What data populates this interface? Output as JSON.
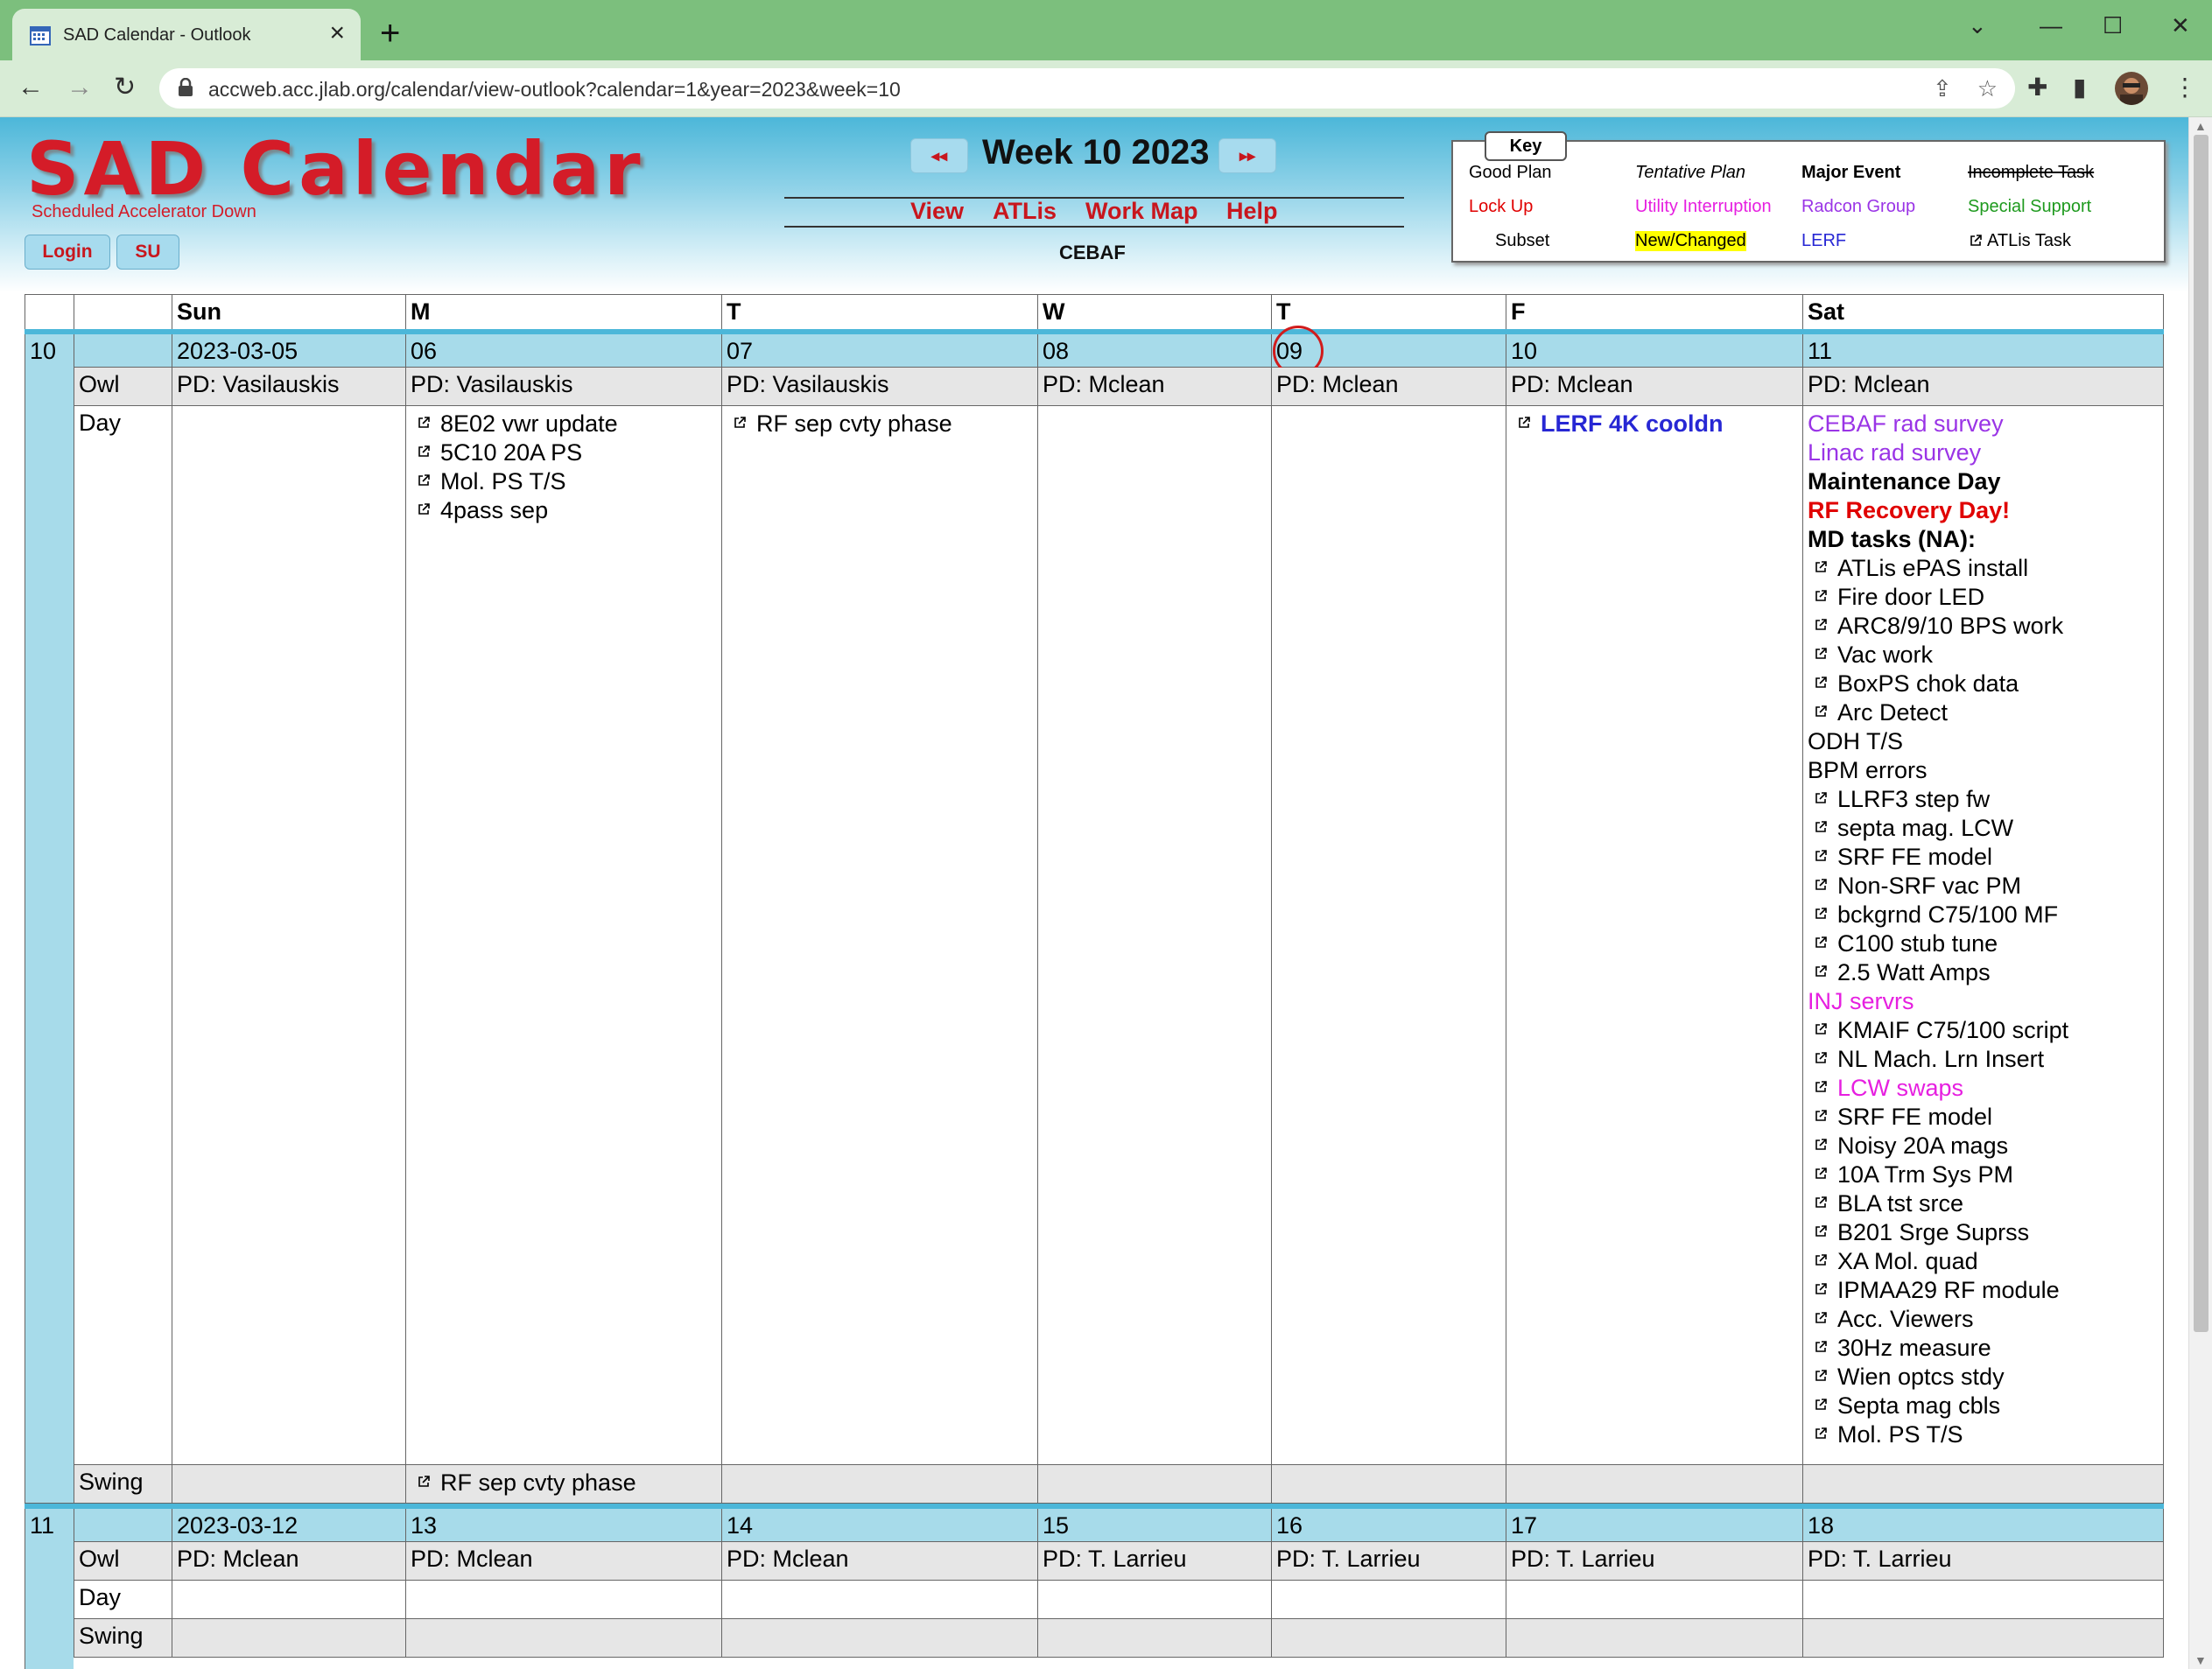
{
  "browser": {
    "tab_title": "SAD Calendar - Outlook",
    "url": "accweb.acc.jlab.org/calendar/view-outlook?calendar=1&year=2023&week=10"
  },
  "header": {
    "logo_title": "SAD Calendar",
    "logo_subtitle": "Scheduled Accelerator Down",
    "login_label": "Login",
    "su_label": "SU",
    "prev_label": "◂◂",
    "next_label": "▸▸",
    "week_title": "Week 10 2023",
    "menu": [
      "View",
      "ATLis",
      "Work Map",
      "Help"
    ],
    "calendar_name": "CEBAF"
  },
  "key": {
    "title": "Key",
    "items": [
      {
        "label": "Good Plan",
        "style": "plain"
      },
      {
        "label": "Tentative Plan",
        "style": "italic"
      },
      {
        "label": "Major Event",
        "style": "bold"
      },
      {
        "label": "Incomplete Task",
        "style": "strike"
      },
      {
        "label": "Lock Up",
        "style": "red"
      },
      {
        "label": "Utility Interruption",
        "style": "magenta"
      },
      {
        "label": "Radcon Group",
        "style": "purple"
      },
      {
        "label": "Special Support",
        "style": "green"
      },
      {
        "label": "Subset",
        "style": "indent"
      },
      {
        "label": "New/Changed",
        "style": "highlight"
      },
      {
        "label": "LERF",
        "style": "blue"
      },
      {
        "label": "ATLis Task",
        "style": "atlis"
      }
    ],
    "colors": {
      "lock_up": "#e00000",
      "utility": "#e61fe0",
      "radcon": "#9a34e6",
      "special": "#1f9a1f",
      "lerf": "#2727d4",
      "new_changed": "#ffff00"
    }
  },
  "calendar": {
    "day_headers": [
      "Sun",
      "M",
      "T",
      "W",
      "T",
      "F",
      "Sat"
    ],
    "week10": {
      "week": "10",
      "dates": [
        "2023-03-05",
        "06",
        "07",
        "08",
        "09",
        "10",
        "11"
      ],
      "owl_label": "Owl",
      "owl": [
        "PD: Vasilauskis",
        "PD: Vasilauskis",
        "PD: Vasilauskis",
        "PD: Mclean",
        "PD: Mclean",
        "PD: Mclean",
        "PD: Mclean"
      ],
      "day_label": "Day",
      "mon_day": [
        "8E02 vwr update",
        "5C10 20A PS",
        "Mol. PS T/S",
        "4pass sep"
      ],
      "tue_day": [
        "RF sep cvty phase"
      ],
      "fri_day": [
        "LERF 4K cooldn"
      ],
      "sat_day": [
        {
          "text": "CEBAF rad survey",
          "cls": "c-purple",
          "link": false
        },
        {
          "text": "Linac rad survey",
          "cls": "c-purple",
          "link": false
        },
        {
          "text": "Maintenance Day",
          "cls": "c-black-bold",
          "link": false
        },
        {
          "text": "RF Recovery Day!",
          "cls": "c-red",
          "link": false
        },
        {
          "text": "MD tasks (NA):",
          "cls": "c-black-bold",
          "link": false
        },
        {
          "text": "ATLis ePAS install",
          "cls": "",
          "link": true
        },
        {
          "text": "Fire door LED",
          "cls": "",
          "link": true
        },
        {
          "text": "ARC8/9/10 BPS work",
          "cls": "",
          "link": true
        },
        {
          "text": "Vac work",
          "cls": "",
          "link": true
        },
        {
          "text": "BoxPS chok data",
          "cls": "",
          "link": true
        },
        {
          "text": "Arc Detect",
          "cls": "",
          "link": true
        },
        {
          "text": "ODH T/S",
          "cls": "",
          "link": false
        },
        {
          "text": "BPM errors",
          "cls": "",
          "link": false
        },
        {
          "text": "LLRF3 step fw",
          "cls": "",
          "link": true
        },
        {
          "text": "septa mag. LCW",
          "cls": "",
          "link": true
        },
        {
          "text": "SRF FE model",
          "cls": "",
          "link": true
        },
        {
          "text": "Non-SRF vac PM",
          "cls": "",
          "link": true
        },
        {
          "text": "bckgrnd C75/100 MF",
          "cls": "",
          "link": true
        },
        {
          "text": "C100 stub tune",
          "cls": "",
          "link": true
        },
        {
          "text": "2.5 Watt Amps",
          "cls": "",
          "link": true
        },
        {
          "text": "INJ servrs",
          "cls": "c-magenta",
          "link": false
        },
        {
          "text": "KMAIF C75/100 script",
          "cls": "",
          "link": true
        },
        {
          "text": "NL Mach. Lrn Insert",
          "cls": "",
          "link": true
        },
        {
          "text": "LCW swaps",
          "cls": "c-magenta",
          "link": true
        },
        {
          "text": "SRF FE model",
          "cls": "",
          "link": true
        },
        {
          "text": "Noisy 20A mags",
          "cls": "",
          "link": true
        },
        {
          "text": "10A Trm Sys PM",
          "cls": "",
          "link": true
        },
        {
          "text": "BLA tst srce",
          "cls": "",
          "link": true
        },
        {
          "text": "B201 Srge Suprss",
          "cls": "",
          "link": true
        },
        {
          "text": "XA Mol. quad",
          "cls": "",
          "link": true
        },
        {
          "text": "IPMAA29 RF module",
          "cls": "",
          "link": true
        },
        {
          "text": "Acc. Viewers",
          "cls": "",
          "link": true
        },
        {
          "text": "30Hz measure",
          "cls": "",
          "link": true
        },
        {
          "text": "Wien optcs stdy",
          "cls": "",
          "link": true
        },
        {
          "text": "Septa mag cbls",
          "cls": "",
          "link": true
        },
        {
          "text": "Mol. PS T/S",
          "cls": "",
          "link": true
        }
      ],
      "swing_label": "Swing",
      "mon_swing": [
        "RF sep cvty phase"
      ]
    },
    "week11": {
      "week": "11",
      "dates": [
        "2023-03-12",
        "13",
        "14",
        "15",
        "16",
        "17",
        "18"
      ],
      "owl_label": "Owl",
      "owl": [
        "PD: Mclean",
        "PD: Mclean",
        "PD: Mclean",
        "PD: T. Larrieu",
        "PD: T. Larrieu",
        "PD: T. Larrieu",
        "PD: T. Larrieu"
      ],
      "day_label": "Day",
      "swing_label": "Swing"
    }
  }
}
